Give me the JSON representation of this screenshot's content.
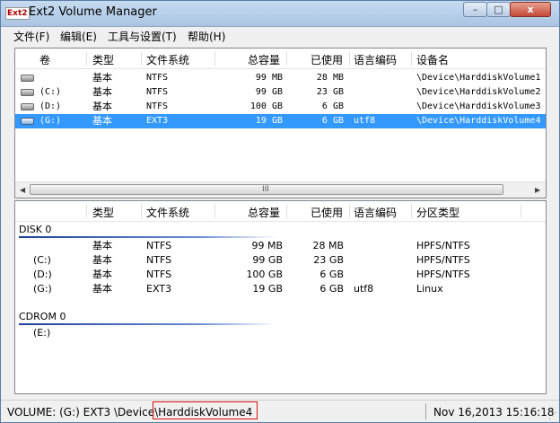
{
  "window": {
    "title": "Ext2 Volume Manager",
    "icon": "Ext2",
    "min": "–",
    "max": "□",
    "close": "x"
  },
  "menu": [
    "文件(F)",
    "编辑(E)",
    "工具与设置(T)",
    "帮助(H)"
  ],
  "volume_table": {
    "headers": [
      "卷",
      "类型",
      "文件系统",
      "总容量",
      "已使用",
      "语言编码",
      "设备名"
    ],
    "rows": [
      {
        "vol": "",
        "type": "基本",
        "fs": "NTFS",
        "total": "99 MB",
        "used": "28 MB",
        "codepage": "",
        "device": "\\Device\\HarddiskVolume1",
        "selected": false
      },
      {
        "vol": "(C:)",
        "type": "基本",
        "fs": "NTFS",
        "total": "99 GB",
        "used": "23 GB",
        "codepage": "",
        "device": "\\Device\\HarddiskVolume2",
        "selected": false
      },
      {
        "vol": "(D:)",
        "type": "基本",
        "fs": "NTFS",
        "total": "100 GB",
        "used": "6 GB",
        "codepage": "",
        "device": "\\Device\\HarddiskVolume3",
        "selected": false
      },
      {
        "vol": "(G:)",
        "type": "基本",
        "fs": "EXT3",
        "total": "19 GB",
        "used": "6 GB",
        "codepage": "utf8",
        "device": "\\Device\\HarddiskVolume4",
        "selected": true
      }
    ],
    "scroll_left_icon": "scroll-left-icon",
    "scroll_right_icon": "scroll-right-icon",
    "grip": "III"
  },
  "disk_table": {
    "headers": [
      "类型",
      "文件系统",
      "总容量",
      "已使用",
      "语言编码",
      "分区类型"
    ],
    "groups": [
      {
        "label": "DISK 0",
        "rows": [
          {
            "vol": "",
            "type": "基本",
            "fs": "NTFS",
            "total": "99 MB",
            "used": "28 MB",
            "codepage": "",
            "ptype": "HPFS/NTFS"
          },
          {
            "vol": "(C:)",
            "type": "基本",
            "fs": "NTFS",
            "total": "99 GB",
            "used": "23 GB",
            "codepage": "",
            "ptype": "HPFS/NTFS"
          },
          {
            "vol": "(D:)",
            "type": "基本",
            "fs": "NTFS",
            "total": "100 GB",
            "used": "6 GB",
            "codepage": "",
            "ptype": "HPFS/NTFS"
          },
          {
            "vol": "(G:)",
            "type": "基本",
            "fs": "EXT3",
            "total": "19 GB",
            "used": "6 GB",
            "codepage": "utf8",
            "ptype": "Linux"
          }
        ]
      },
      {
        "label": "CDROM 0",
        "rows": [
          {
            "vol": "(E:)",
            "type": "",
            "fs": "",
            "total": "",
            "used": "",
            "codepage": "",
            "ptype": ""
          }
        ]
      }
    ]
  },
  "status": {
    "volume": "VOLUME: (G:) EXT3 \\Device\\HarddiskVolume4",
    "datetime": "Nov 16,2013 15:16:18"
  },
  "colors": {
    "selection": "#3399ff",
    "highlight_box": "#e01010"
  }
}
